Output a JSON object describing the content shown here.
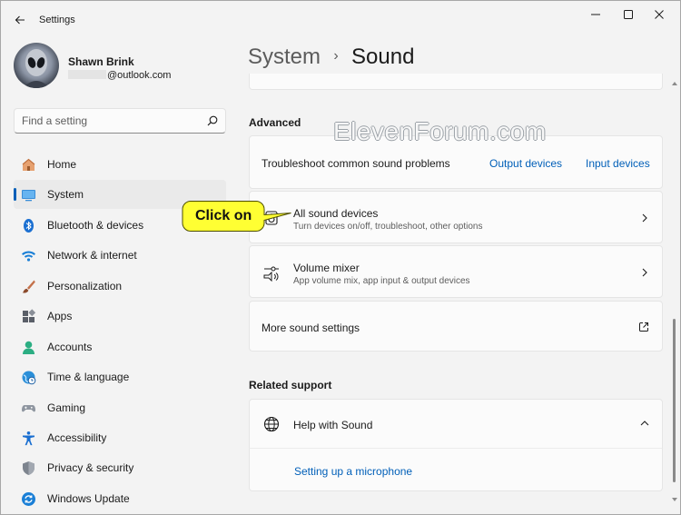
{
  "window": {
    "title": "Settings"
  },
  "user": {
    "name": "Shawn Brink",
    "email_suffix": "@outlook.com"
  },
  "search": {
    "placeholder": "Find a setting"
  },
  "nav": {
    "items": [
      {
        "label": "Home",
        "icon": "home-icon"
      },
      {
        "label": "System",
        "icon": "system-icon",
        "active": true
      },
      {
        "label": "Bluetooth & devices",
        "icon": "bluetooth-icon"
      },
      {
        "label": "Network & internet",
        "icon": "wifi-icon"
      },
      {
        "label": "Personalization",
        "icon": "brush-icon"
      },
      {
        "label": "Apps",
        "icon": "apps-icon"
      },
      {
        "label": "Accounts",
        "icon": "accounts-icon"
      },
      {
        "label": "Time & language",
        "icon": "globe-clock-icon"
      },
      {
        "label": "Gaming",
        "icon": "gamepad-icon"
      },
      {
        "label": "Accessibility",
        "icon": "accessibility-icon"
      },
      {
        "label": "Privacy & security",
        "icon": "shield-icon"
      },
      {
        "label": "Windows Update",
        "icon": "update-icon"
      }
    ]
  },
  "breadcrumb": {
    "parent": "System",
    "separator": "›",
    "current": "Sound"
  },
  "advanced": {
    "title": "Advanced",
    "troubleshoot": {
      "label": "Troubleshoot common sound problems",
      "link_output": "Output devices",
      "link_input": "Input devices"
    },
    "all_devices": {
      "label": "All sound devices",
      "description": "Turn devices on/off, troubleshoot, other options"
    },
    "volume_mixer": {
      "label": "Volume mixer",
      "description": "App volume mix, app input & output devices"
    },
    "more_settings": {
      "label": "More sound settings"
    }
  },
  "related": {
    "title": "Related support",
    "help": {
      "label": "Help with Sound",
      "link": "Setting up a microphone"
    }
  },
  "callout": {
    "text": "Click on"
  },
  "watermark": {
    "text": "ElevenForum.com"
  },
  "colors": {
    "accent": "#005fb8",
    "callout_fill": "#ffff33",
    "window_bg": "#f3f3f3",
    "card_bg": "#fbfbfb"
  }
}
